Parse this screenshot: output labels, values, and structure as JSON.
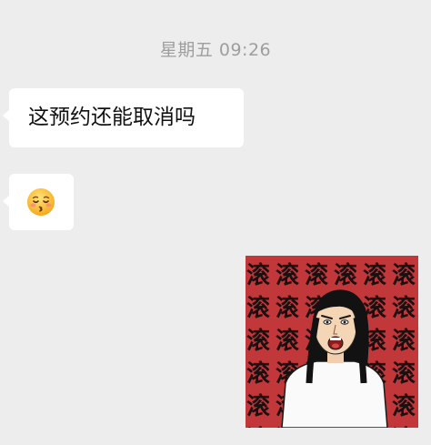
{
  "chat": {
    "timestamp": "星期五 09:26",
    "messages": [
      {
        "type": "text",
        "text": "这预约还能取消吗"
      },
      {
        "type": "emoji",
        "emoji": "kissing-face-with-closed-eyes"
      },
      {
        "type": "sticker",
        "sticker": "screaming-woman-sticker",
        "pattern_char": "滚"
      }
    ]
  },
  "colors": {
    "background": "#ededed",
    "bubble": "#ffffff",
    "timestamp": "#9e9e9e",
    "sticker_bg": "#c2373a"
  }
}
